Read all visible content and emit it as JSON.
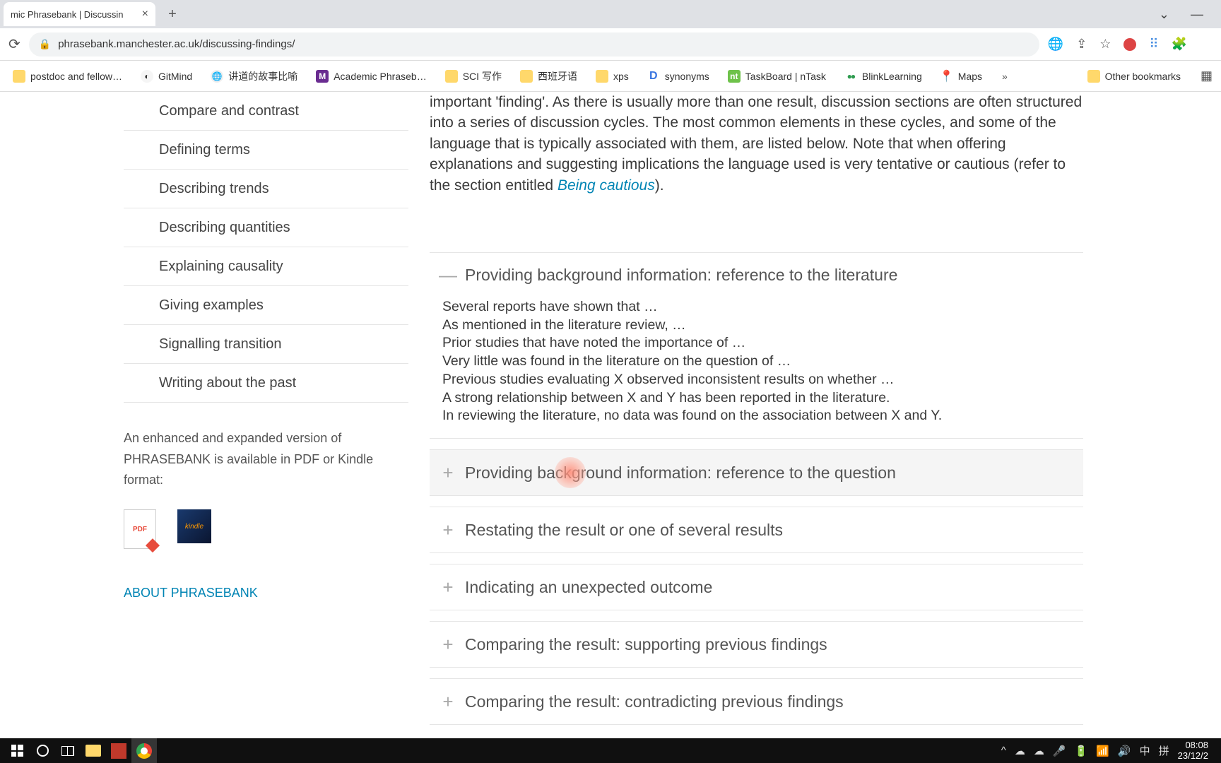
{
  "browser": {
    "tab_title": "mic Phrasebank | Discussin",
    "url": "phrasebank.manchester.ac.uk/discussing-findings/"
  },
  "bookmarks_bar": [
    {
      "label": "postdoc and fellow…",
      "icon": "folder"
    },
    {
      "label": "GitMind",
      "icon": "gitmind"
    },
    {
      "label": "讲道的故事比喻",
      "icon": "globe"
    },
    {
      "label": "Academic Phraseb…",
      "icon": "m"
    },
    {
      "label": "SCI 写作",
      "icon": "folder"
    },
    {
      "label": "西班牙语",
      "icon": "folder"
    },
    {
      "label": "xps",
      "icon": "folder"
    },
    {
      "label": "synonyms",
      "icon": "d"
    },
    {
      "label": "TaskBoard | nTask",
      "icon": "nt"
    },
    {
      "label": "BlinkLearning",
      "icon": "bl"
    },
    {
      "label": "Maps",
      "icon": "maps"
    }
  ],
  "other_bookmarks_label": "Other bookmarks",
  "sidebar": {
    "menu": [
      "Compare and contrast",
      "Defining terms",
      "Describing trends",
      "Describing quantities",
      "Explaining causality",
      "Giving examples",
      "Signalling transition",
      "Writing about the past"
    ],
    "note": "An enhanced and expanded version of PHRASEBANK is available in PDF or Kindle format:",
    "about_link": "ABOUT PHRASEBANK"
  },
  "main": {
    "intro": "important 'finding'. As there is usually more than one result, discussion sections are often structured into a series of discussion cycles. The most common elements in these cycles, and some of the language that is typically associated with them, are listed below. Note that when offering explanations and suggesting implications the language used is very tentative or cautious (refer to the section entitled ",
    "cautious_link": "Being cautious",
    "intro_tail": ").",
    "accordion": [
      {
        "title": "Providing background information: reference to the literature",
        "expanded": true,
        "lines": [
          "Several reports have shown that …",
          "As mentioned in the literature review, …",
          "Prior studies that have noted the importance of …",
          "Very little was found in the literature on the question of …",
          "Previous studies evaluating X observed inconsistent results on whether …",
          "A strong relationship between X and Y has been reported in the literature.",
          "In reviewing the literature, no data was found on the association between X and Y."
        ]
      },
      {
        "title": "Providing background information: reference to the question",
        "expanded": false,
        "hovered": true
      },
      {
        "title": "Restating the result or one of several results",
        "expanded": false
      },
      {
        "title": "Indicating an unexpected outcome",
        "expanded": false
      },
      {
        "title": "Comparing the result: supporting previous findings",
        "expanded": false
      },
      {
        "title": "Comparing the result: contradicting previous findings",
        "expanded": false
      }
    ]
  },
  "taskbar": {
    "time": "08:08",
    "date": "23/12/2",
    "ime1": "中",
    "ime2": "拼"
  }
}
